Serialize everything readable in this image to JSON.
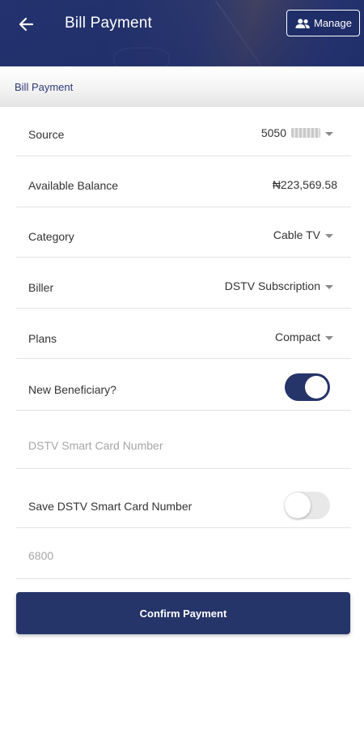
{
  "header": {
    "title": "Bill Payment",
    "manage_label": "Manage"
  },
  "section": {
    "title": "Bill Payment"
  },
  "form": {
    "source": {
      "label": "Source",
      "value": "5050"
    },
    "available_balance": {
      "label": "Available Balance",
      "value": "₦223,569.58"
    },
    "category": {
      "label": "Category",
      "value": "Cable TV"
    },
    "biller": {
      "label": "Biller",
      "value": "DSTV Subscription"
    },
    "plans": {
      "label": "Plans",
      "value": "Compact"
    },
    "new_beneficiary": {
      "label": "New Beneficiary?",
      "enabled": true
    },
    "smart_card": {
      "placeholder": "DSTV Smart Card Number",
      "value": ""
    },
    "save_smart_card": {
      "label": "Save DSTV Smart Card Number",
      "enabled": false
    },
    "amount": {
      "placeholder": "6800",
      "value": ""
    }
  },
  "confirm_label": "Confirm Payment",
  "colors": {
    "primary": "#253469",
    "header": "#1f2d69",
    "section_text": "#2c3b78"
  },
  "icons": {
    "back": "arrow-left-icon",
    "manage": "people-icon",
    "dropdown": "caret-down-icon"
  }
}
